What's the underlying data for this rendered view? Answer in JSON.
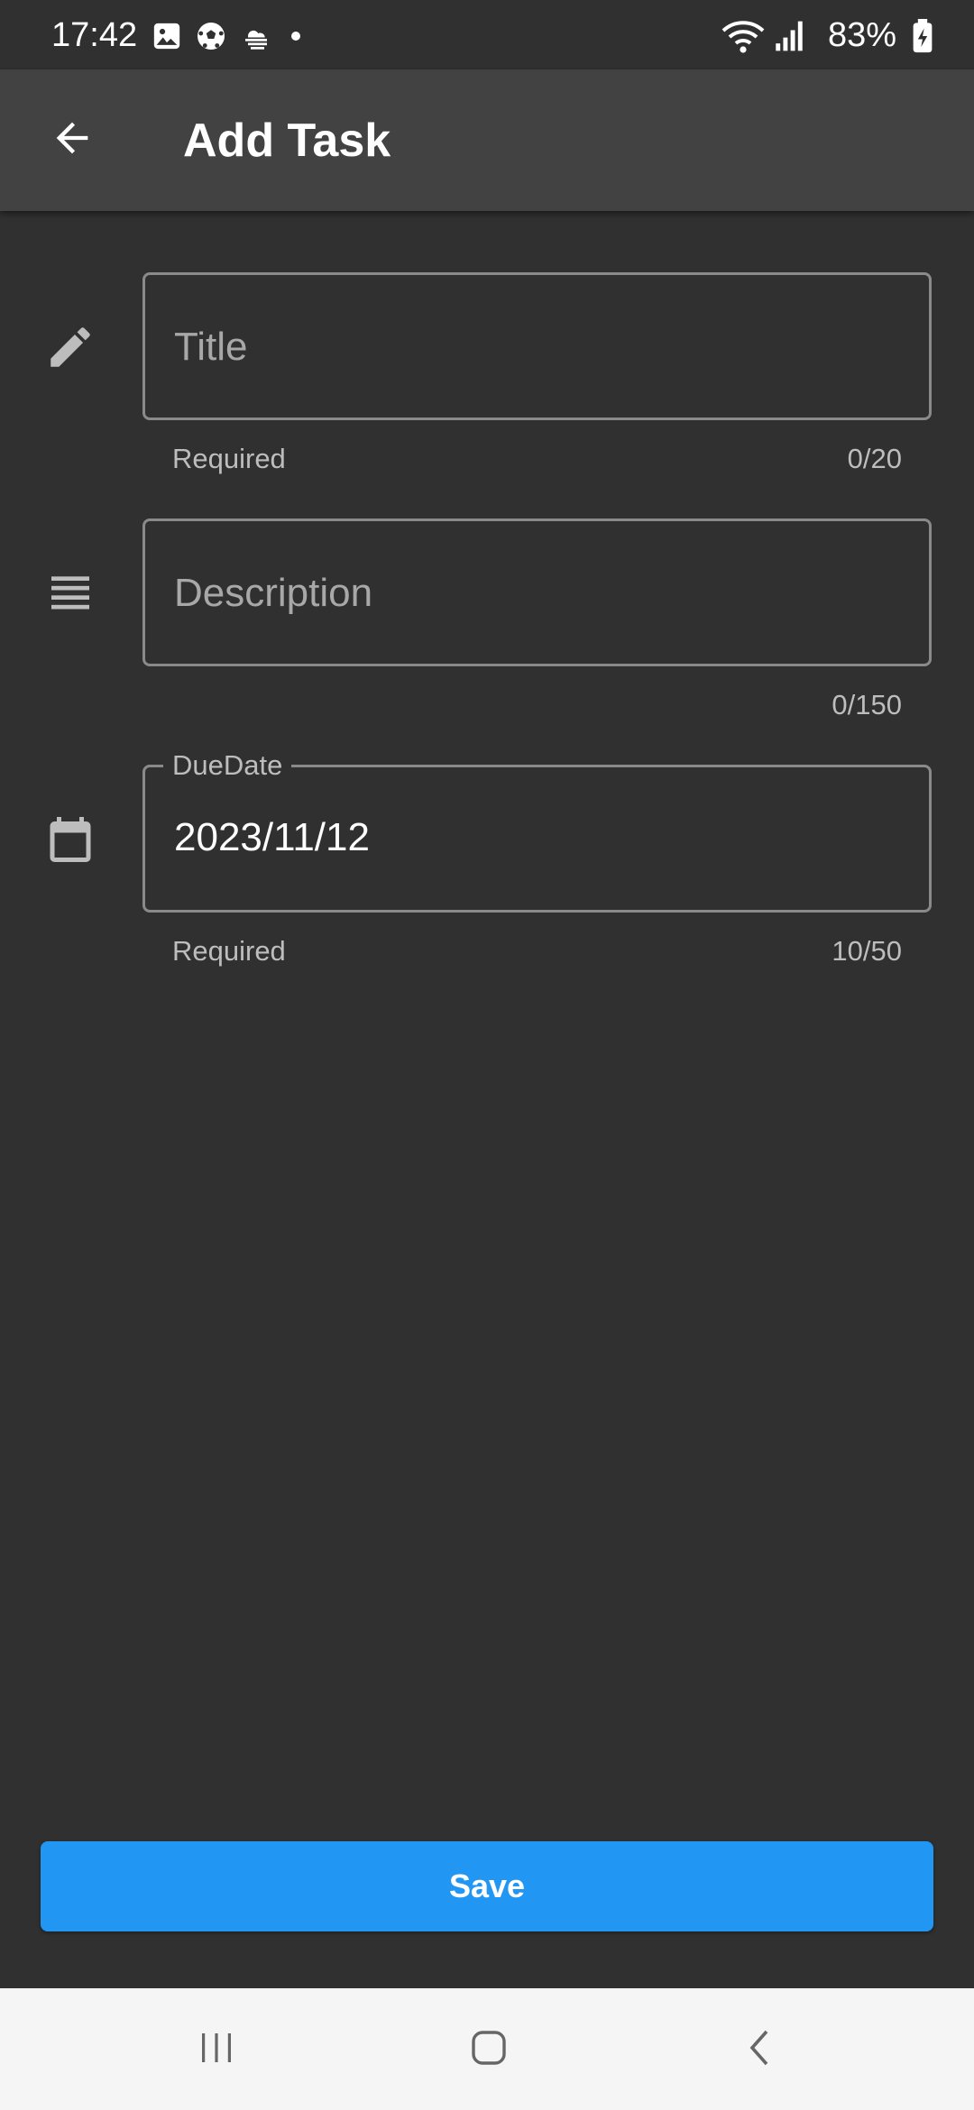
{
  "status_bar": {
    "time": "17:42",
    "battery": "83%",
    "icons_left": [
      "image-icon",
      "soccer-ball-icon",
      "cloud-icon",
      "dot-icon"
    ],
    "icons_right": [
      "wifi-icon",
      "signal-icon",
      "battery-charging-icon"
    ]
  },
  "app_bar": {
    "title": "Add Task",
    "back_icon": "arrow-back-icon"
  },
  "form": {
    "title_field": {
      "icon": "pencil-icon",
      "placeholder": "Title",
      "value": "",
      "helper": "Required",
      "counter": "0/20"
    },
    "description_field": {
      "icon": "lines-icon",
      "placeholder": "Description",
      "value": "",
      "counter": "0/150"
    },
    "due_date_field": {
      "icon": "calendar-icon",
      "label": "DueDate",
      "value": "2023/11/12",
      "helper": "Required",
      "counter": "10/50"
    }
  },
  "save_button": {
    "label": "Save",
    "color": "#2196F3"
  },
  "nav_bar": {
    "buttons": [
      "recents-icon",
      "home-icon",
      "back-icon"
    ]
  },
  "colors": {
    "background": "#303030",
    "app_bar": "#424242",
    "accent": "#2196F3"
  }
}
